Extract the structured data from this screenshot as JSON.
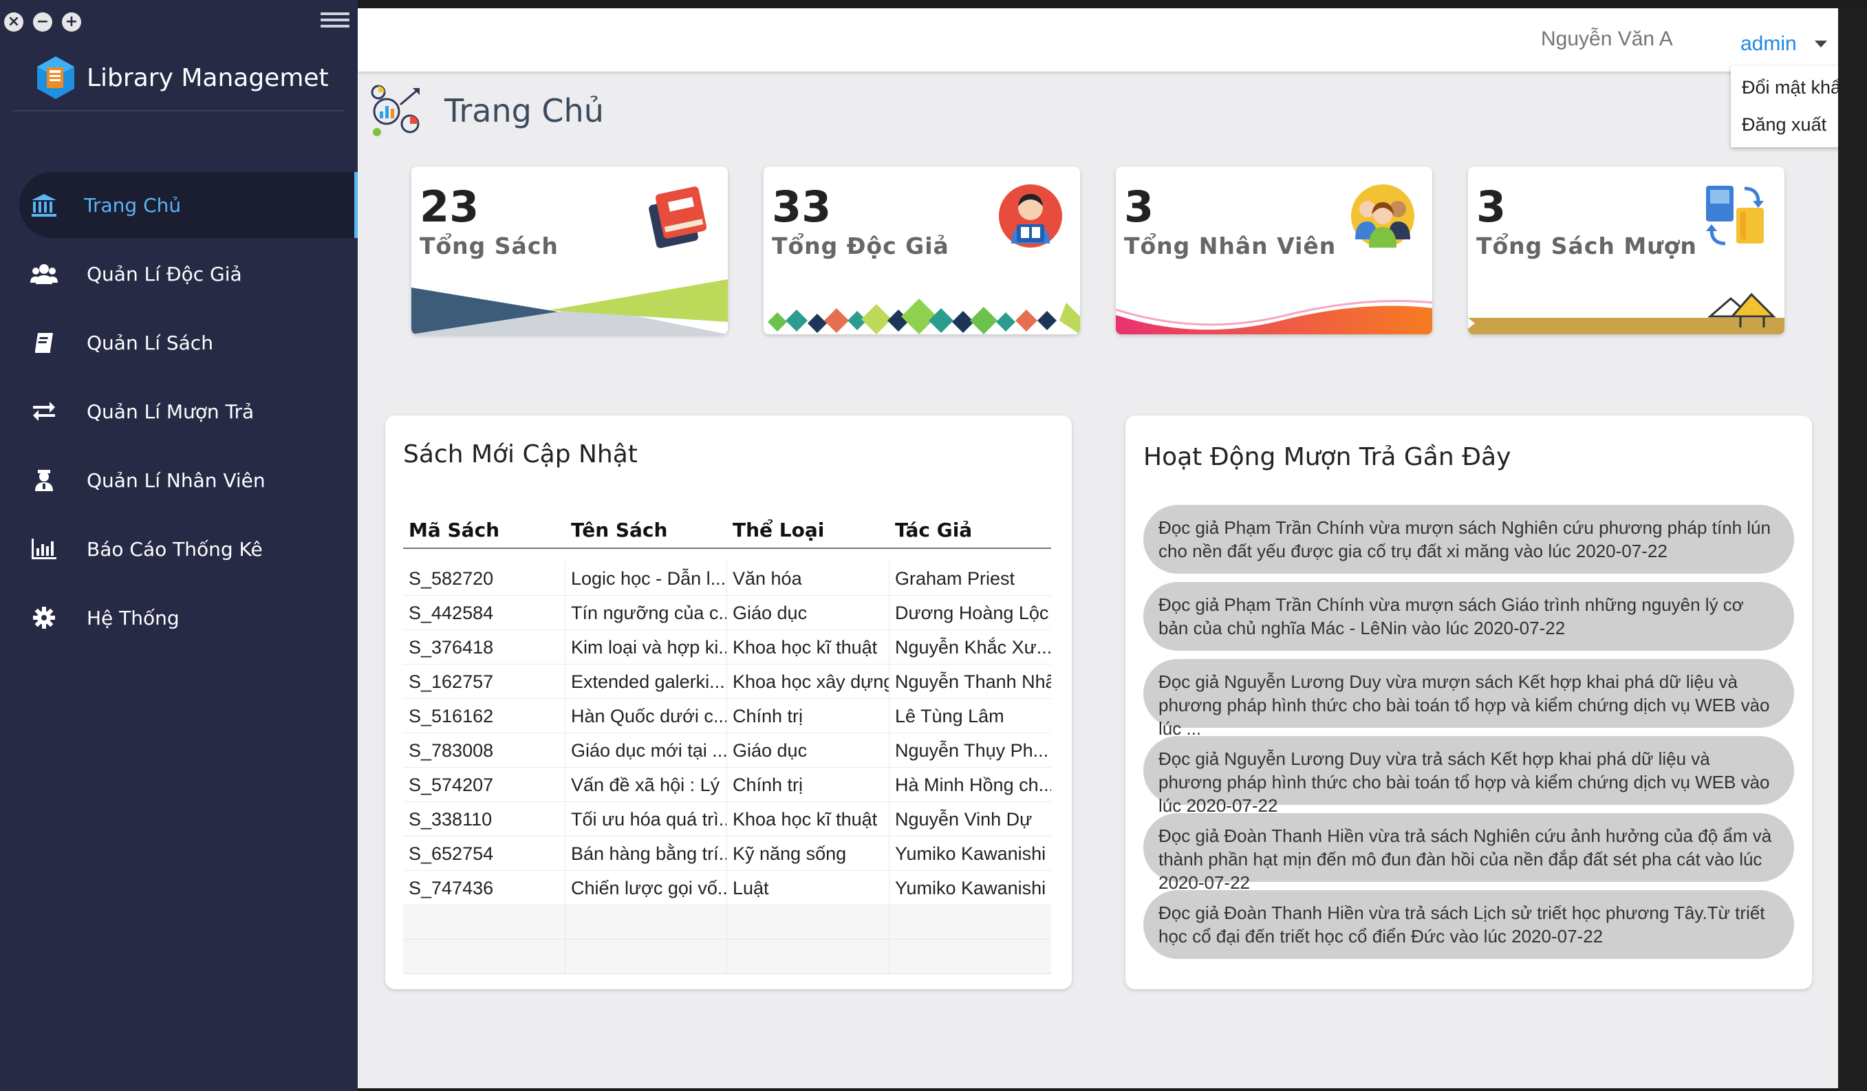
{
  "app": {
    "title": "Library Managemet"
  },
  "window_controls": [
    "close",
    "minimize",
    "maximize"
  ],
  "sidebar": {
    "items": [
      {
        "label": "Trang Chủ",
        "icon": "bank-icon",
        "active": true
      },
      {
        "label": "Quản Lí Độc Giả",
        "icon": "users-icon",
        "active": false
      },
      {
        "label": "Quản Lí Sách",
        "icon": "book-icon",
        "active": false
      },
      {
        "label": "Quản Lí Mượn Trả",
        "icon": "exchange-icon",
        "active": false
      },
      {
        "label": "Quản Lí Nhân Viên",
        "icon": "staff-icon",
        "active": false
      },
      {
        "label": "Báo Cáo Thống Kê",
        "icon": "bar-chart-icon",
        "active": false
      },
      {
        "label": "Hệ Thống",
        "icon": "gear-icon",
        "active": false
      }
    ]
  },
  "header": {
    "user_name": "Nguyễn Văn A",
    "role": "admin",
    "menu": [
      "Đổi mật khẩu",
      "Đăng xuất"
    ]
  },
  "page": {
    "title": "Trang Chủ"
  },
  "stats": [
    {
      "value": "23",
      "label": "Tổng Sách"
    },
    {
      "value": "33",
      "label": "Tổng Độc Giả"
    },
    {
      "value": "3",
      "label": "Tổng Nhân Viên"
    },
    {
      "value": "3",
      "label": "Tổng Sách Mượn"
    }
  ],
  "new_books": {
    "title": "Sách Mới Cập Nhật",
    "columns": [
      "Mã Sách",
      "Tên Sách",
      "Thể Loại",
      "Tác Giả"
    ],
    "rows": [
      [
        "S_582720",
        "Logic học - Dẫn l...",
        "Văn hóa",
        "Graham Priest"
      ],
      [
        "S_442584",
        "Tín ngưỡng của c...",
        "Giáo dục",
        "Dương Hoàng Lộc"
      ],
      [
        "S_376418",
        "Kim loại và hợp ki...",
        "Khoa học kĩ thuật",
        "Nguyễn Khắc Xư..."
      ],
      [
        "S_162757",
        "Extended galerki...",
        "Khoa học xây dựng",
        "Nguyễn Thanh Nhã"
      ],
      [
        "S_516162",
        "Hàn Quốc dưới c...",
        "Chính trị",
        "Lê Tùng Lâm"
      ],
      [
        "S_783008",
        "Giáo dục mới tại ...",
        "Giáo dục",
        "Nguyễn Thụy Ph..."
      ],
      [
        "S_574207",
        "Vấn đề xã hội : Lý ...",
        "Chính trị",
        "Hà Minh Hồng ch..."
      ],
      [
        "S_338110",
        "Tối ưu hóa quá trì...",
        "Khoa học kĩ thuật",
        "Nguyễn Vinh Dự"
      ],
      [
        "S_652754",
        "Bán hàng bằng trí...",
        "Kỹ năng sống",
        "Yumiko Kawanishi"
      ],
      [
        "S_747436",
        "Chiến lược gọi vố...",
        "Luật",
        "Yumiko Kawanishi"
      ]
    ]
  },
  "activity": {
    "title": "Hoạt Động Mượn Trả Gần Đây",
    "items": [
      "Đọc giả Phạm Trần Chính vừa mượn sách Nghiên cứu phương pháp tính lún cho nền đất yếu được gia cố trụ đất xi măng vào lúc 2020-07-22",
      "Đọc giả Phạm Trần Chính vừa mượn sách Giáo trình những nguyên lý cơ bản của chủ nghĩa Mác - LêNin vào lúc 2020-07-22",
      "Đọc giả Nguyễn Lương Duy vừa mượn sách Kết hợp khai phá dữ liệu và phương pháp hình thức cho bài toán tổ hợp và kiểm chứng dịch vụ WEB vào lúc ...",
      "Đọc giả Nguyễn Lương Duy vừa trả sách Kết hợp khai phá dữ liệu và phương pháp hình thức cho bài toán tổ hợp và kiểm chứng dịch vụ WEB vào lúc 2020-07-22",
      "Đọc giả Đoàn Thanh Hiền vừa trả sách Nghiên cứu ảnh hưởng của độ ẩm và thành phần hạt mịn đến mô đun đàn hồi của nền đắp đất sét pha cát vào lúc 2020-07-22",
      "Đọc giả Đoàn Thanh Hiền vừa trả sách Lịch sử triết học phương Tây.Từ triết học cổ đại đến triết học cổ điển Đức vào lúc 2020-07-22"
    ]
  },
  "colors": {
    "sidebar_bg": "#262a45",
    "accent": "#58b6f5",
    "main_bg": "#ededf0"
  }
}
